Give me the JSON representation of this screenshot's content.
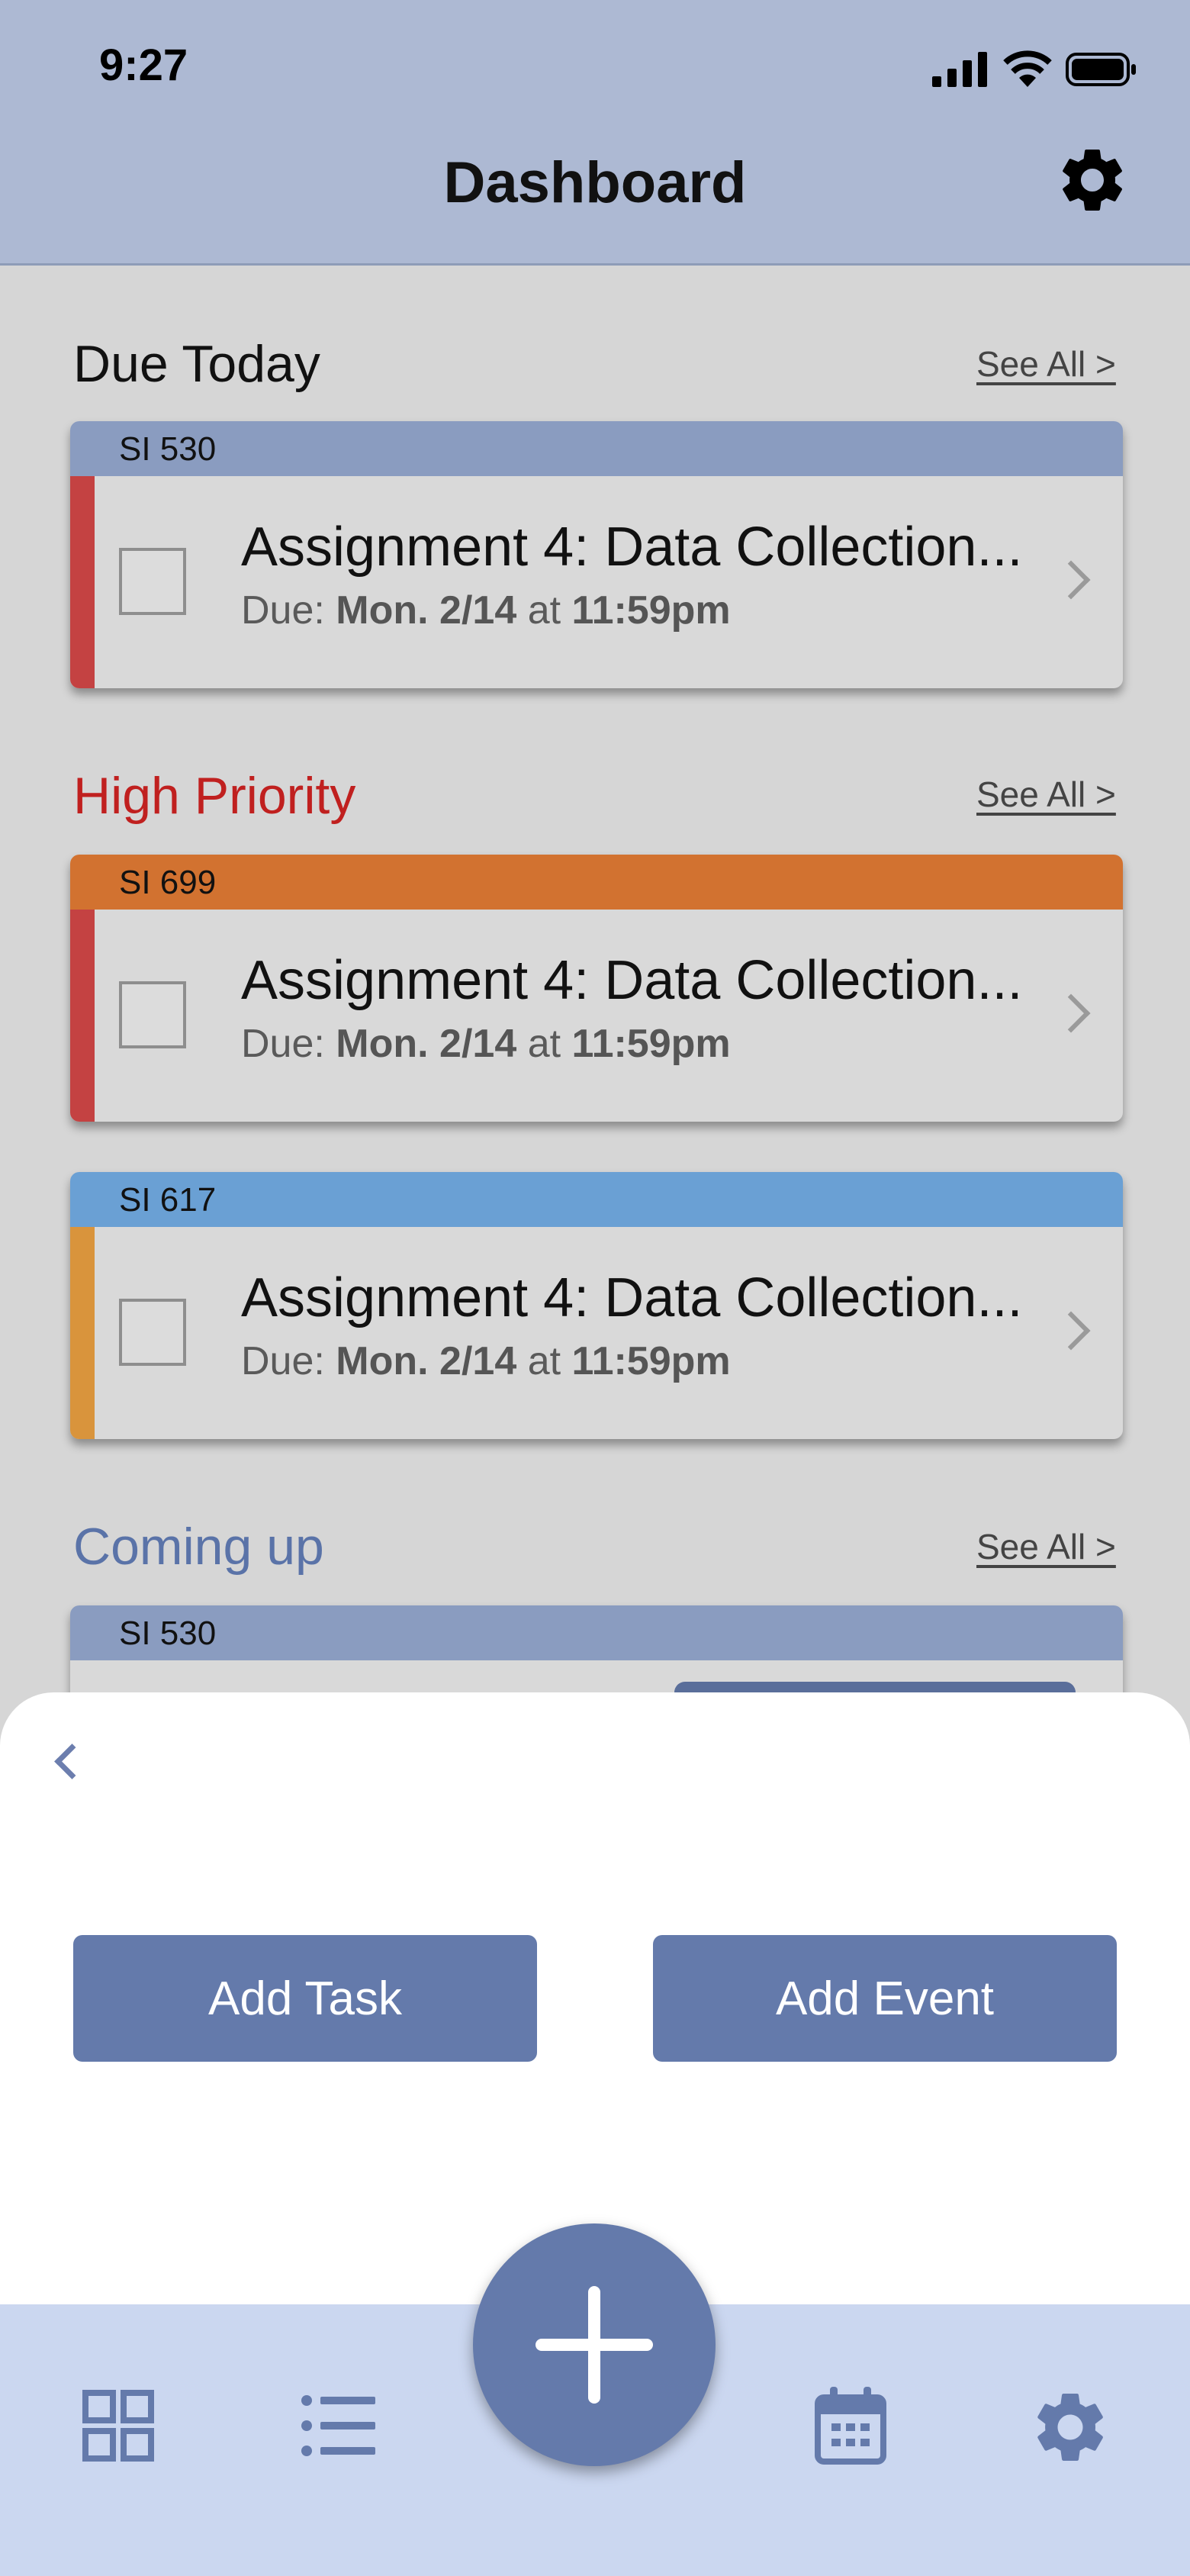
{
  "status_bar": {
    "time": "9:27"
  },
  "header": {
    "title": "Dashboard"
  },
  "sections": {
    "due_today": {
      "title": "Due Today",
      "see_all": "See All >"
    },
    "high_priority": {
      "title": "High Priority",
      "see_all": "See All >"
    },
    "coming_up": {
      "title": "Coming up",
      "see_all": "See All >"
    }
  },
  "cards": [
    {
      "course": "SI 530",
      "title": "Assignment 4: Data Collection...",
      "due_prefix": "Due: ",
      "due_day": "Mon. 2/14",
      "due_at": " at ",
      "due_time": "11:59pm"
    },
    {
      "course": "SI 699",
      "title": "Assignment 4: Data Collection...",
      "due_prefix": "Due: ",
      "due_day": "Mon. 2/14",
      "due_at": " at ",
      "due_time": "11:59pm"
    },
    {
      "course": "SI 617",
      "title": "Assignment 4: Data Collection...",
      "due_prefix": "Due: ",
      "due_day": "Mon. 2/14",
      "due_at": " at ",
      "due_time": "11:59pm"
    },
    {
      "course": "SI 530"
    }
  ],
  "sheet": {
    "add_task": "Add Task",
    "add_event": "Add Event"
  },
  "tabbar": {
    "items": [
      "dashboard-icon",
      "list-icon",
      "add-icon",
      "calendar-icon",
      "settings-icon"
    ]
  },
  "colors": {
    "header_bg": "#adb9d3",
    "accent": "#647aab",
    "high_priority": "#c0201f",
    "coming_up": "#5a73a8",
    "course_si530": "#8a9cc0",
    "course_si699": "#d27230",
    "course_si617": "#6aa0d4",
    "stripe_red": "#c44242",
    "stripe_orange": "#d9943c"
  }
}
